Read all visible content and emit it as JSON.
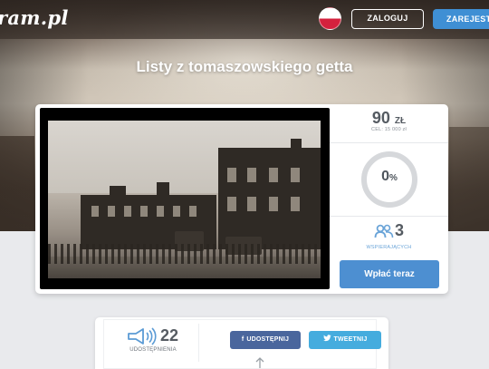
{
  "header": {
    "logo": "ram.pl",
    "login_label": "ZALOGUJ",
    "register_label": "ZAREJESTRUJ",
    "flag_icon": "poland-flag-icon"
  },
  "campaign": {
    "title": "Listy z tomaszowskiego getta",
    "raised_amount": "90",
    "currency": "ZŁ",
    "goal_text": "CEL: 15 000 zł",
    "progress_value": "0",
    "progress_unit": "%",
    "progress_fraction": 0,
    "supporters_count": "3",
    "supporters_label": "WSPIERAJĄCYCH",
    "pay_button_label": "Wpłać teraz"
  },
  "share": {
    "count": "22",
    "label": "UDOSTĘPNIENIA",
    "facebook_icon": "f",
    "facebook_label": "UDOSTĘPNIJ",
    "twitter_label": "TWEETNIJ"
  },
  "colors": {
    "accent_blue": "#4d8fd1",
    "facebook": "#4a669d",
    "twitter": "#45acde",
    "supporter_icon": "#6aa4d8"
  }
}
